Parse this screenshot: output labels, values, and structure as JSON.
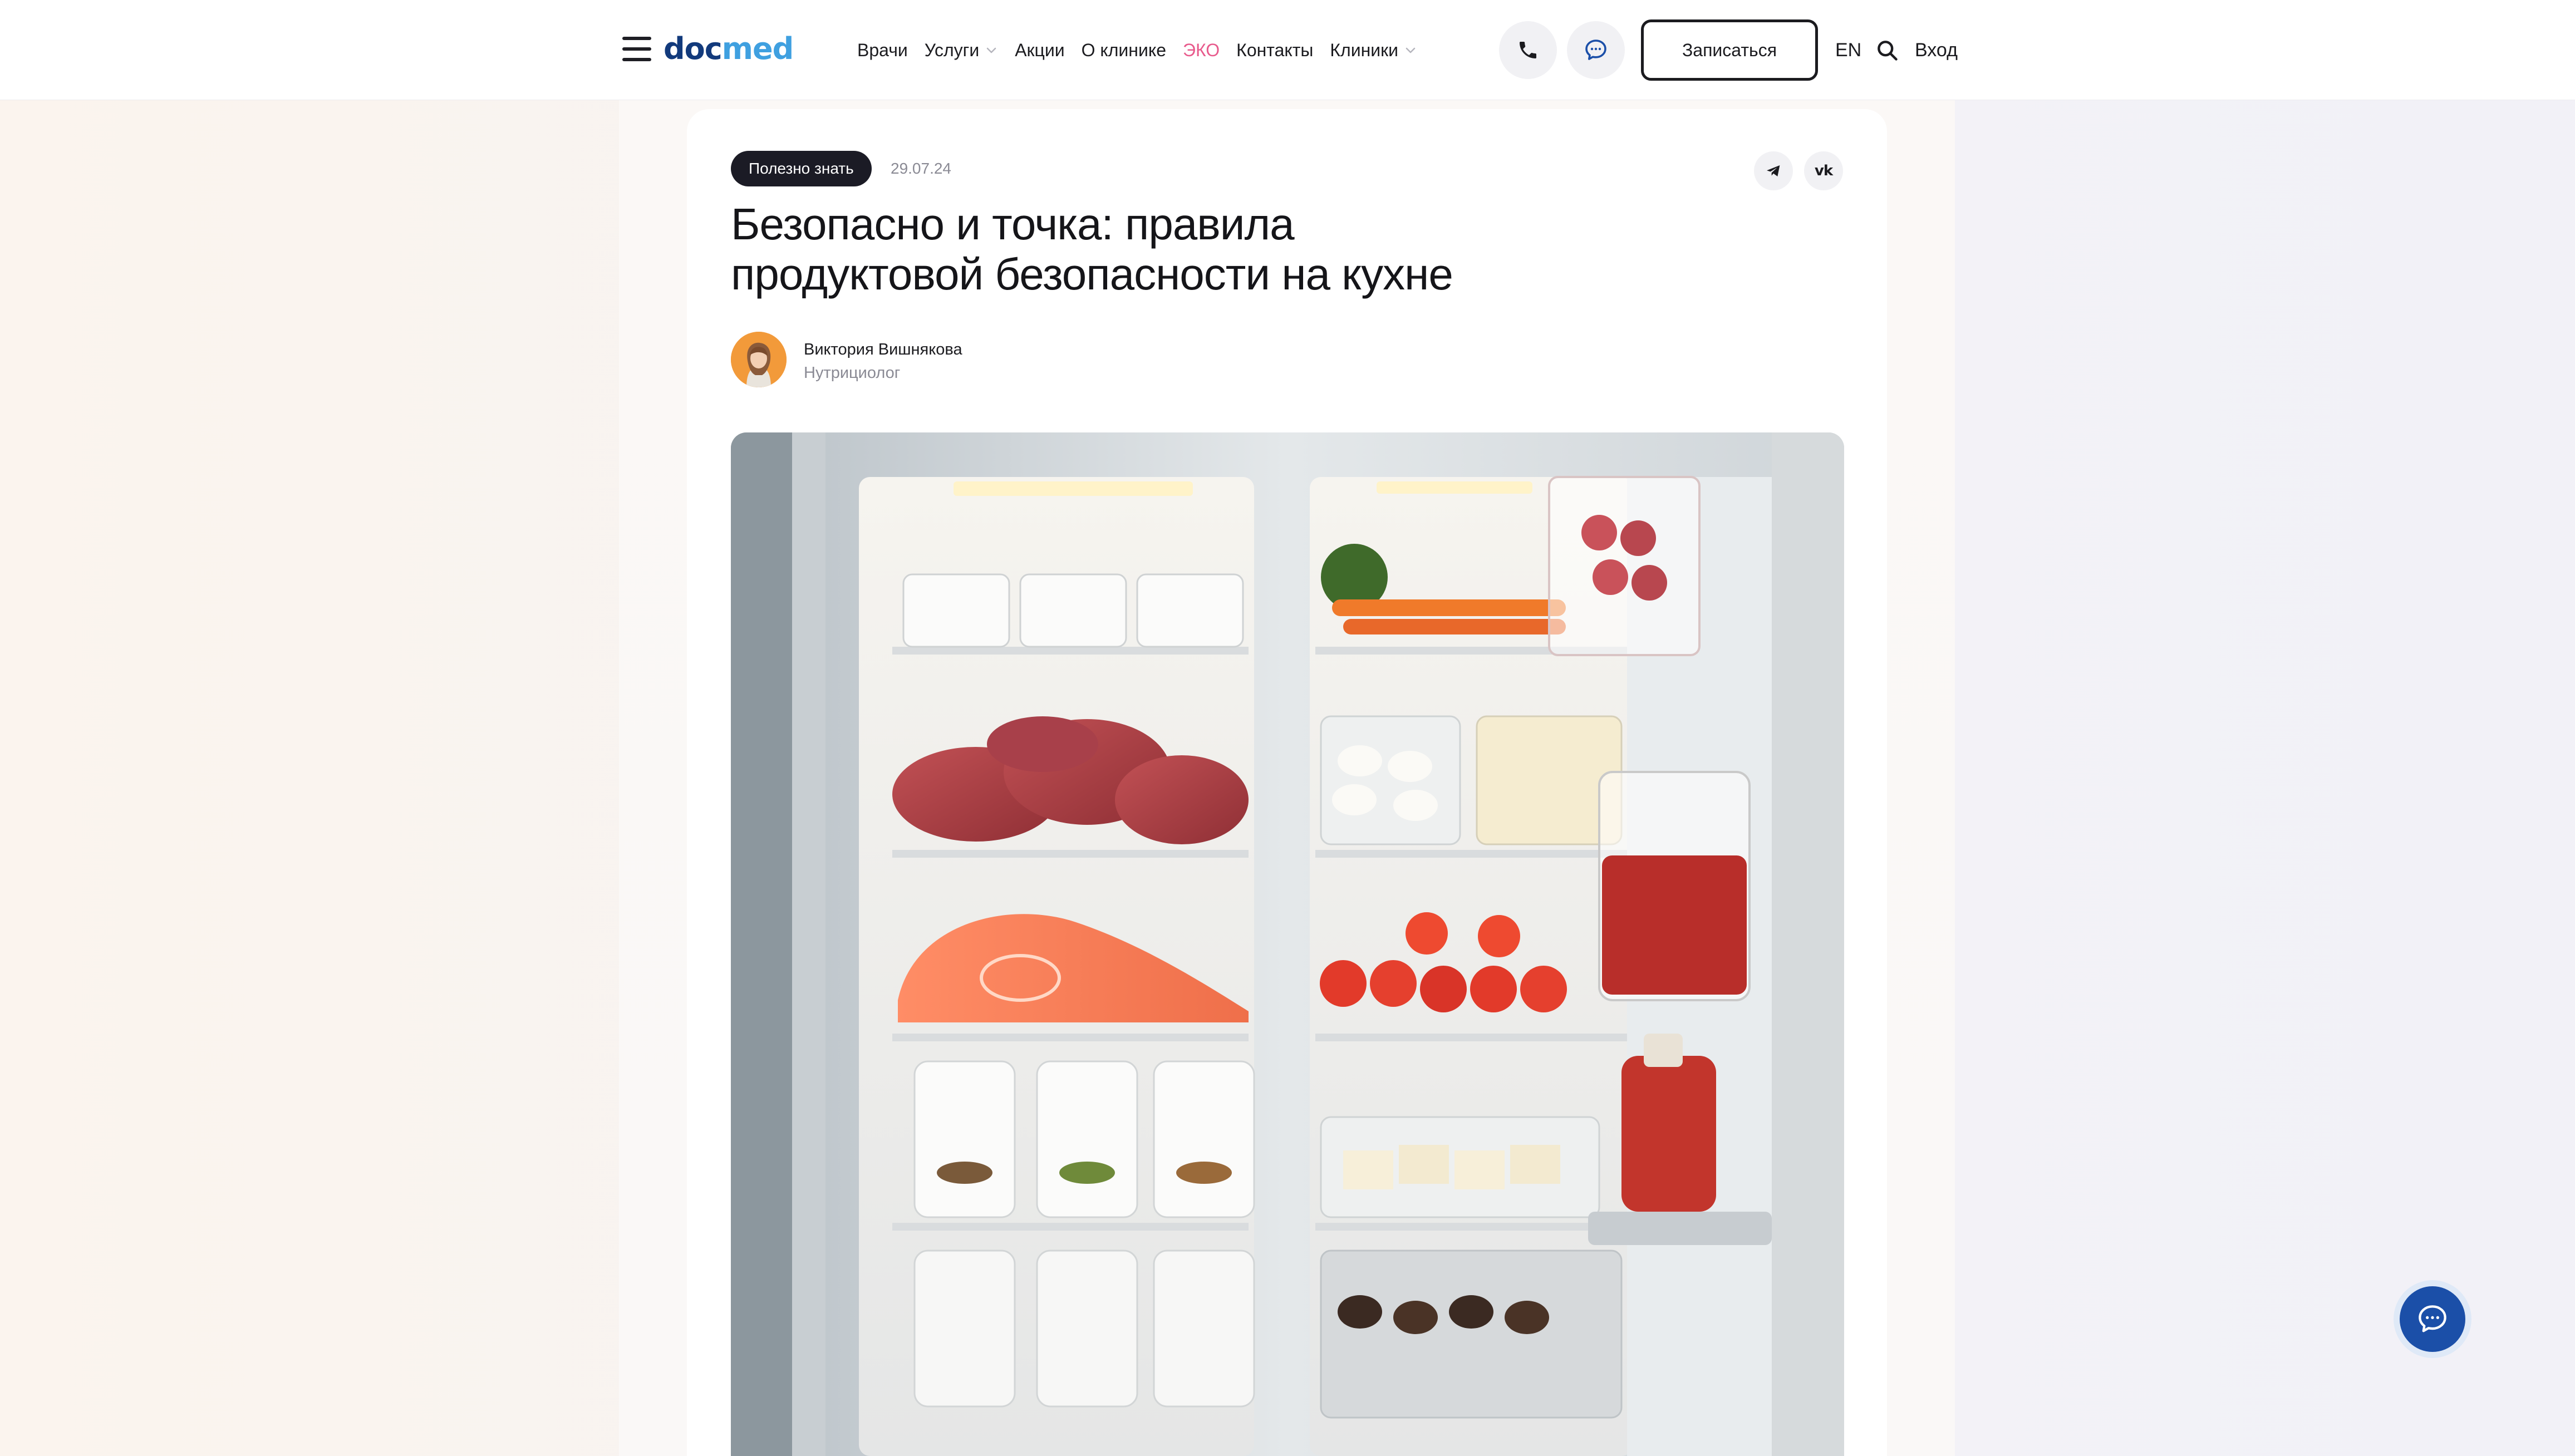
{
  "brand": {
    "logo_part1": "doc",
    "logo_part2": "med",
    "primary_color": "#123a7c",
    "accent_color": "#3fa0e0",
    "eko_color": "#e85a8c"
  },
  "header": {
    "menu_icon": "burger-menu-icon",
    "nav": [
      {
        "label": "Врачи",
        "has_dropdown": false
      },
      {
        "label": "Услуги",
        "has_dropdown": true
      },
      {
        "label": "Акции",
        "has_dropdown": false
      },
      {
        "label": "О клинике",
        "has_dropdown": false
      },
      {
        "label": "ЭКО",
        "has_dropdown": false
      },
      {
        "label": "Контакты",
        "has_dropdown": false
      },
      {
        "label": "Клиники",
        "has_dropdown": true
      }
    ],
    "phone_icon": "phone-icon",
    "chat_icon": "chat-bubble-icon",
    "signup_label": "Записаться",
    "lang_label": "EN",
    "search_icon": "search-icon",
    "login_label": "Вход"
  },
  "article": {
    "category_badge": "Полезно знать",
    "date": "29.07.24",
    "share": {
      "telegram_icon": "telegram-icon",
      "vk_label": "vk"
    },
    "title_lines": [
      "Безопасно и точка: правила",
      "продуктовой безопасности на кухне"
    ],
    "author": {
      "name": "Виктория Вишнякова",
      "role": "Нутрициолог"
    },
    "hero_image": "open-refrigerator-with-food-illustration"
  },
  "floating": {
    "chat_icon": "chat-support-icon"
  }
}
